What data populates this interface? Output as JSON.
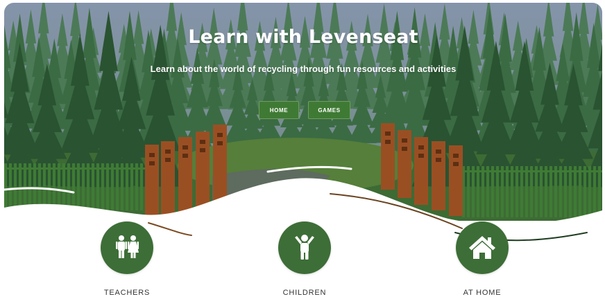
{
  "hero": {
    "title": "Learn with Levenseat",
    "subtitle": "Learn about the world of recycling through fun resources and activities"
  },
  "nav": {
    "home_label": "HOME",
    "games_label": "GAMES"
  },
  "cards": [
    {
      "label": "TEACHERS",
      "icon": "teachers-icon"
    },
    {
      "label": "CHILDREN",
      "icon": "child-icon"
    },
    {
      "label": "AT HOME",
      "icon": "house-icon"
    }
  ],
  "colors": {
    "sky": "#7f8fa6",
    "forest_dark": "#2c5434",
    "forest_mid": "#3b6b3f",
    "gate": "#9a4f23",
    "button": "#3f7a34",
    "icon_circle": "#3d6e37",
    "label_text": "#333333"
  }
}
